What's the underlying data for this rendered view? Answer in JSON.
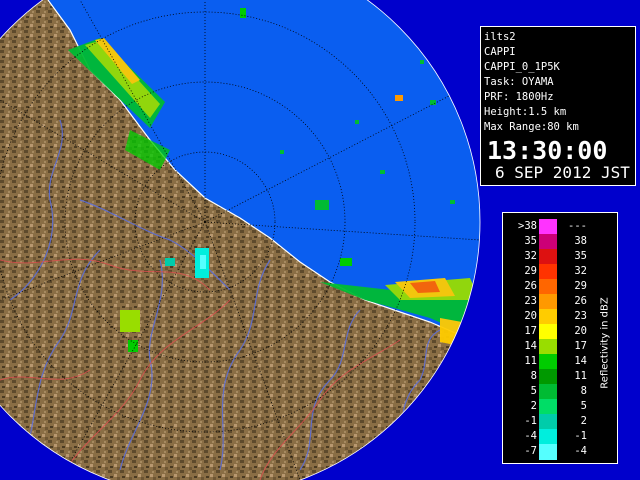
{
  "info": {
    "lines": [
      "ilts2",
      "CAPPI",
      "CAPPI_0_1P5K",
      "Task: OYAMA",
      "PRF: 1800Hz",
      "Height:1.5 km",
      "Max Range:80 km"
    ],
    "time": "13:30:00",
    "date": "6 SEP 2012 JST"
  },
  "legend": {
    "unit_label": "Reflectivity in dBZ",
    "rows": [
      {
        "low": ">38",
        "high": "---",
        "color": "#ff33ff"
      },
      {
        "low": "35",
        "high": "38",
        "color": "#cc0077"
      },
      {
        "low": "32",
        "high": "35",
        "color": "#dd1111"
      },
      {
        "low": "29",
        "high": "32",
        "color": "#ff3300"
      },
      {
        "low": "26",
        "high": "29",
        "color": "#ff6600"
      },
      {
        "low": "23",
        "high": "26",
        "color": "#ff9900"
      },
      {
        "low": "20",
        "high": "23",
        "color": "#ffcc00"
      },
      {
        "low": "17",
        "high": "20",
        "color": "#ffff00"
      },
      {
        "low": "14",
        "high": "17",
        "color": "#99dd00"
      },
      {
        "low": "11",
        "high": "14",
        "color": "#00cc00"
      },
      {
        "low": "8",
        "high": "11",
        "color": "#009900"
      },
      {
        "low": "5",
        "high": "8",
        "color": "#00bb33"
      },
      {
        "low": "2",
        "high": "5",
        "color": "#00dd66"
      },
      {
        "low": "-1",
        "high": "2",
        "color": "#00ccaa"
      },
      {
        "low": "-4",
        "high": "-1",
        "color": "#00eedd"
      },
      {
        "low": "-7",
        "high": "-4",
        "color": "#55ffff"
      }
    ]
  },
  "colors": {
    "sea": "#0a5ef0",
    "outside": "#0000cc",
    "land": "#8a6e45",
    "rivers": "#5a6ee0",
    "boundaries": "#e05050"
  }
}
